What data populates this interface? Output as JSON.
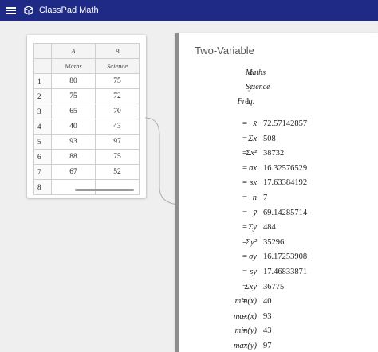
{
  "app": {
    "title": "ClassPad Math"
  },
  "spreadsheet": {
    "columns": [
      "A",
      "B"
    ],
    "header_row": [
      "Maths",
      "Science"
    ],
    "rows": [
      {
        "n": "1",
        "a": "80",
        "b": "75"
      },
      {
        "n": "2",
        "a": "75",
        "b": "72"
      },
      {
        "n": "3",
        "a": "65",
        "b": "70"
      },
      {
        "n": "4",
        "a": "40",
        "b": "43"
      },
      {
        "n": "5",
        "a": "93",
        "b": "97"
      },
      {
        "n": "6",
        "a": "88",
        "b": "75"
      },
      {
        "n": "7",
        "a": "67",
        "b": "52"
      },
      {
        "n": "8",
        "a": "",
        "b": ""
      }
    ]
  },
  "panel": {
    "title": "Two-Variable",
    "config": [
      {
        "label": "x:",
        "value": "Maths"
      },
      {
        "label": "y:",
        "value": "Science"
      },
      {
        "label": "Freq:",
        "value": "1"
      }
    ],
    "stats": [
      {
        "label": "x̄",
        "eq": "=",
        "value": "72.57142857"
      },
      {
        "label": "Σx",
        "eq": "=",
        "value": "508"
      },
      {
        "label": "Σx²",
        "eq": "=",
        "value": "38732"
      },
      {
        "label": "σx",
        "eq": "=",
        "value": "16.32576529"
      },
      {
        "label": "sx",
        "eq": "=",
        "value": "17.63384192"
      },
      {
        "label": "n",
        "eq": "=",
        "value": "7"
      },
      {
        "label": "ȳ",
        "eq": "=",
        "value": "69.14285714"
      },
      {
        "label": "Σy",
        "eq": "=",
        "value": "484"
      },
      {
        "label": "Σy²",
        "eq": "=",
        "value": "35296"
      },
      {
        "label": "σy",
        "eq": "=",
        "value": "16.17253908"
      },
      {
        "label": "sy",
        "eq": "=",
        "value": "17.46833871"
      },
      {
        "label": "Σxy",
        "eq": "=",
        "value": "36775"
      },
      {
        "label": "min(x)",
        "eq": "=",
        "value": "40"
      },
      {
        "label": "max(x)",
        "eq": "=",
        "value": "93"
      },
      {
        "label": "min(y)",
        "eq": "=",
        "value": "43"
      },
      {
        "label": "max(y)",
        "eq": "=",
        "value": "97"
      }
    ]
  }
}
